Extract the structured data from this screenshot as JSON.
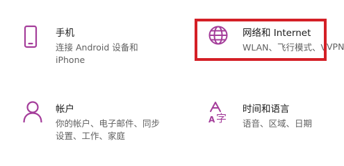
{
  "accent_color": "#a43d9a",
  "highlight_color": "#d41f26",
  "tiles": {
    "phone": {
      "icon": "phone-icon",
      "title": "手机",
      "desc_line1": "连接 Android 设备和",
      "desc_line2": "iPhone"
    },
    "network": {
      "icon": "globe-icon",
      "title": "网络和 Internet",
      "desc": "WLAN、飞行模式、VPN"
    },
    "accounts": {
      "icon": "person-icon",
      "title": "帐户",
      "desc_line1": "你的帐户、电子邮件、同步",
      "desc_line2": "设置、工作、家庭"
    },
    "time_language": {
      "icon": "time-language-icon",
      "title": "时间和语言",
      "desc": "语音、区域、日期"
    }
  }
}
